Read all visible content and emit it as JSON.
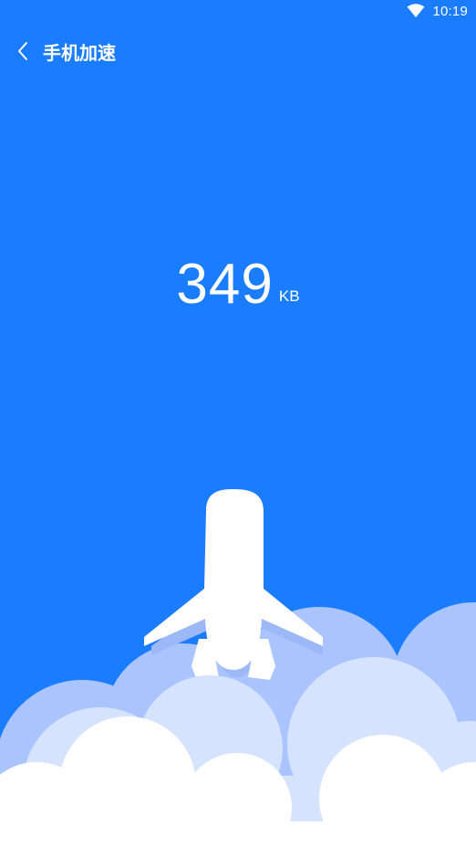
{
  "status_bar": {
    "time": "10:19",
    "wifi_icon": "wifi-icon"
  },
  "header": {
    "back_icon": "chevron-left-icon",
    "title": "手机加速"
  },
  "speed": {
    "value": "349",
    "unit": "KB"
  },
  "illustration": {
    "airplane_icon": "airplane-icon",
    "cloud_colors": [
      "#a9c4ff",
      "#d6e3ff",
      "#ffffff"
    ]
  },
  "colors": {
    "background": "#1a7cff",
    "text": "#ffffff"
  }
}
